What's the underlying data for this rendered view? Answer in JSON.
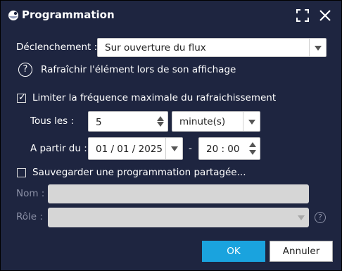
{
  "window": {
    "title": "Programmation"
  },
  "trigger": {
    "label": "Déclenchement :",
    "value": "Sur ouverture du flux"
  },
  "refresh_info": {
    "text": "Rafraîchir l'élément lors de son affichage"
  },
  "limit": {
    "label": "Limiter la fréquence maximale du rafraichissement",
    "checked": true
  },
  "every": {
    "label": "Tous les :",
    "value": "5",
    "unit": "minute(s)"
  },
  "from": {
    "label": "A partir du :",
    "date": "01 / 01 / 2025",
    "separator": "-",
    "time": "20 : 00"
  },
  "shared": {
    "label": "Sauvegarder une programmation partagée...",
    "checked": false
  },
  "name": {
    "label": "Nom :",
    "value": ""
  },
  "role": {
    "label": "Rôle :",
    "value": ""
  },
  "buttons": {
    "ok": "OK",
    "cancel": "Annuler"
  },
  "colors": {
    "background": "#1e2540",
    "accent": "#1aa3de",
    "disabled_text": "#8b90a6"
  }
}
